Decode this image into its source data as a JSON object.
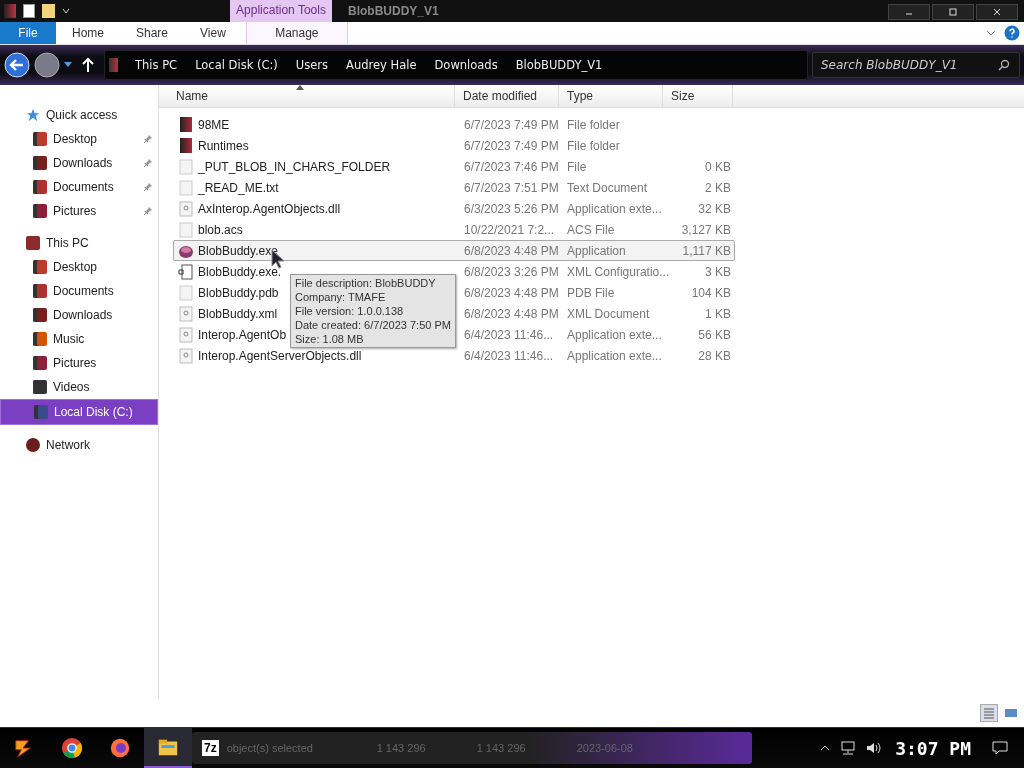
{
  "window": {
    "title": "BlobBUDDY_V1",
    "context_tab": "Application Tools"
  },
  "ribbon_tabs": [
    {
      "label": "File",
      "selected": true
    },
    {
      "label": "Home",
      "selected": false
    },
    {
      "label": "Share",
      "selected": false
    },
    {
      "label": "View",
      "selected": false
    },
    {
      "label": "Manage",
      "selected": false
    }
  ],
  "breadcrumb": [
    "This PC",
    "Local Disk (C:)",
    "Users",
    "Audrey Hale",
    "Downloads",
    "BlobBUDDY_V1"
  ],
  "search": {
    "placeholder": "Search BlobBUDDY_V1"
  },
  "sidebar": [
    {
      "label": "Quick access",
      "kind": "star",
      "selected": false,
      "children": [
        {
          "label": "Desktop",
          "kind": "desktop",
          "pinned": true,
          "selected": false
        },
        {
          "label": "Downloads",
          "kind": "downloads",
          "pinned": true,
          "selected": false
        },
        {
          "label": "Documents",
          "kind": "documents",
          "pinned": true,
          "selected": false
        },
        {
          "label": "Pictures",
          "kind": "pictures",
          "pinned": true,
          "selected": false
        }
      ]
    },
    {
      "label": "This PC",
      "kind": "pc",
      "selected": false,
      "children": [
        {
          "label": "Desktop",
          "kind": "desktop",
          "pinned": false,
          "selected": false
        },
        {
          "label": "Documents",
          "kind": "documents",
          "pinned": false,
          "selected": false
        },
        {
          "label": "Downloads",
          "kind": "downloads",
          "pinned": false,
          "selected": false
        },
        {
          "label": "Music",
          "kind": "music",
          "pinned": false,
          "selected": false
        },
        {
          "label": "Pictures",
          "kind": "pictures",
          "pinned": false,
          "selected": false
        },
        {
          "label": "Videos",
          "kind": "videos",
          "pinned": false,
          "selected": false
        },
        {
          "label": "Local Disk (C:)",
          "kind": "disk",
          "pinned": false,
          "selected": true
        }
      ]
    },
    {
      "label": "Network",
      "kind": "network",
      "selected": false
    }
  ],
  "table": {
    "columns": [
      "Name",
      "Date modified",
      "Type",
      "Size"
    ],
    "rows": [
      {
        "name": "98ME",
        "kind": "folder",
        "date": "6/7/2023 7:49 PM",
        "type": "File folder",
        "size": "",
        "selected": false
      },
      {
        "name": "Runtimes",
        "kind": "folder",
        "date": "6/7/2023 7:49 PM",
        "type": "File folder",
        "size": "",
        "selected": false
      },
      {
        "name": "_PUT_BLOB_IN_CHARS_FOLDER",
        "kind": "file",
        "date": "6/7/2023 7:46 PM",
        "type": "File",
        "size": "0 KB",
        "selected": false
      },
      {
        "name": "_READ_ME.txt",
        "kind": "file",
        "date": "6/7/2023 7:51 PM",
        "type": "Text Document",
        "size": "2 KB",
        "selected": false
      },
      {
        "name": "AxInterop.AgentObjects.dll",
        "kind": "dll",
        "date": "6/3/2023 5:26 PM",
        "type": "Application exte...",
        "size": "32 KB",
        "selected": false
      },
      {
        "name": "blob.acs",
        "kind": "file",
        "date": "10/22/2021 7:2...",
        "type": "ACS File",
        "size": "3,127 KB",
        "selected": false
      },
      {
        "name": "BlobBuddy.exe",
        "kind": "app",
        "date": "6/8/2023 4:48 PM",
        "type": "Application",
        "size": "1,117 KB",
        "selected": true
      },
      {
        "name": "BlobBuddy.exe.",
        "kind": "config",
        "date": "6/8/2023 3:26 PM",
        "type": "XML Configuratio...",
        "size": "3 KB",
        "selected": false
      },
      {
        "name": "BlobBuddy.pdb",
        "kind": "file",
        "date": "6/8/2023 4:48 PM",
        "type": "PDB File",
        "size": "104 KB",
        "selected": false
      },
      {
        "name": "BlobBuddy.xml",
        "kind": "xml",
        "date": "6/8/2023 4:48 PM",
        "type": "XML Document",
        "size": "1 KB",
        "selected": false
      },
      {
        "name": "Interop.AgentOb",
        "kind": "dll",
        "date": "6/4/2023 11:46...",
        "type": "Application exte...",
        "size": "56 KB",
        "selected": false
      },
      {
        "name": "Interop.AgentServerObjects.dll",
        "kind": "dll",
        "date": "6/4/2023 11:46...",
        "type": "Application exte...",
        "size": "28 KB",
        "selected": false
      }
    ]
  },
  "tooltip": [
    "File description: BlobBUDDY",
    "Company: TMAFE",
    "File version: 1.0.0.138",
    "Date created: 6/7/2023 7:50 PM",
    "Size: 1.08 MB"
  ],
  "taskbar": {
    "apps": [
      {
        "kind": "start",
        "selected": false
      },
      {
        "kind": "chrome",
        "selected": false
      },
      {
        "kind": "firefox",
        "selected": false
      },
      {
        "kind": "explorer",
        "selected": true
      },
      {
        "kind": "sevenzip",
        "selected": false
      }
    ],
    "progress": {
      "label": "7z",
      "texts": [
        "object(s) selected",
        "1 143 296",
        "1 143 296",
        "2023-06-08"
      ]
    },
    "clock": "3:07 PM"
  }
}
